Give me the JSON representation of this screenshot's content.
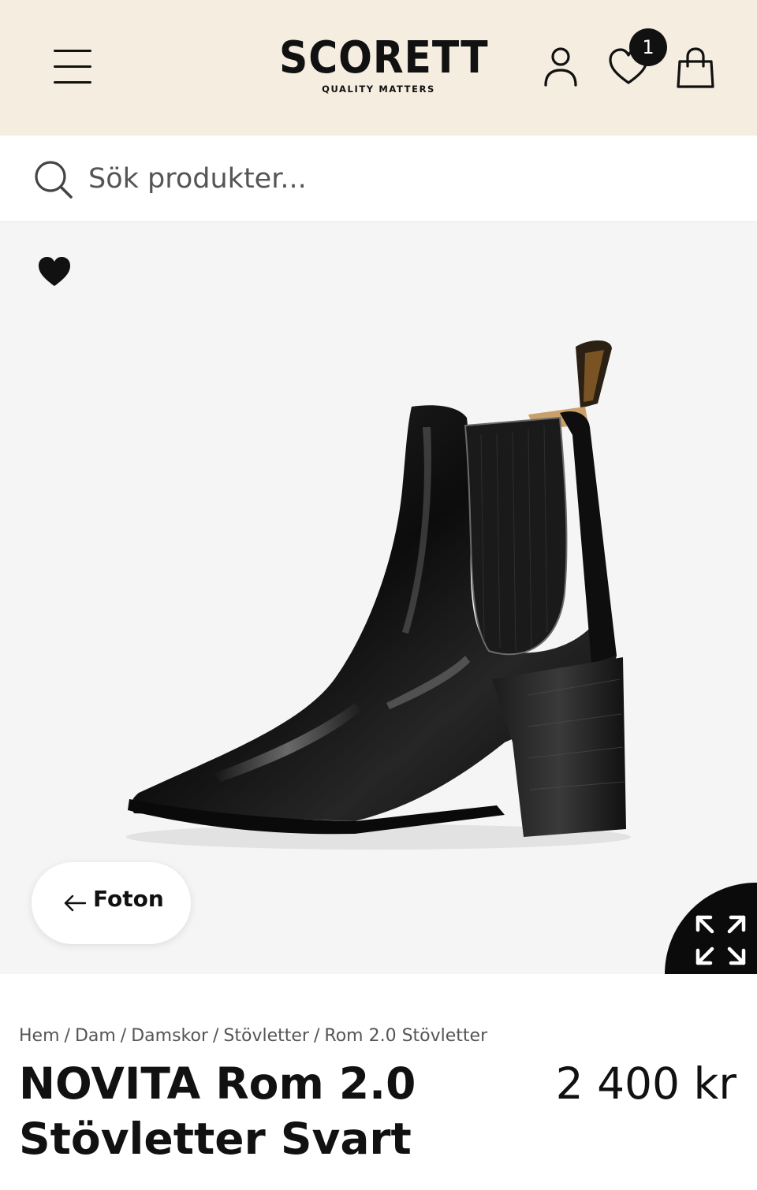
{
  "header": {
    "logo_text": "SCORETT",
    "logo_tagline": "QUALITY MATTERS",
    "wishlist_count": "1",
    "icons": [
      "menu-icon",
      "account-icon",
      "heart-icon",
      "shopping-bag-icon"
    ]
  },
  "search": {
    "placeholder": "Sök produkter..."
  },
  "gallery": {
    "back_label": "Foton",
    "back_arrow": "←",
    "favorite_state": "filled",
    "icons": [
      "heart-icon",
      "arrow-left-icon",
      "expand-icon"
    ]
  },
  "breadcrumb": {
    "items": [
      "Hem",
      "Dam",
      "Damskor",
      "Stövletter",
      "Rom 2.0 Stövletter"
    ],
    "separator": "/"
  },
  "product": {
    "brand": "NOVITA",
    "name": "Rom 2.0 Stövletter Svart",
    "price": "2 400 kr"
  },
  "colors": {
    "header_bg": "#f4ede0",
    "gallery_bg": "#f5f5f5",
    "text": "#111111",
    "muted": "#555555"
  }
}
